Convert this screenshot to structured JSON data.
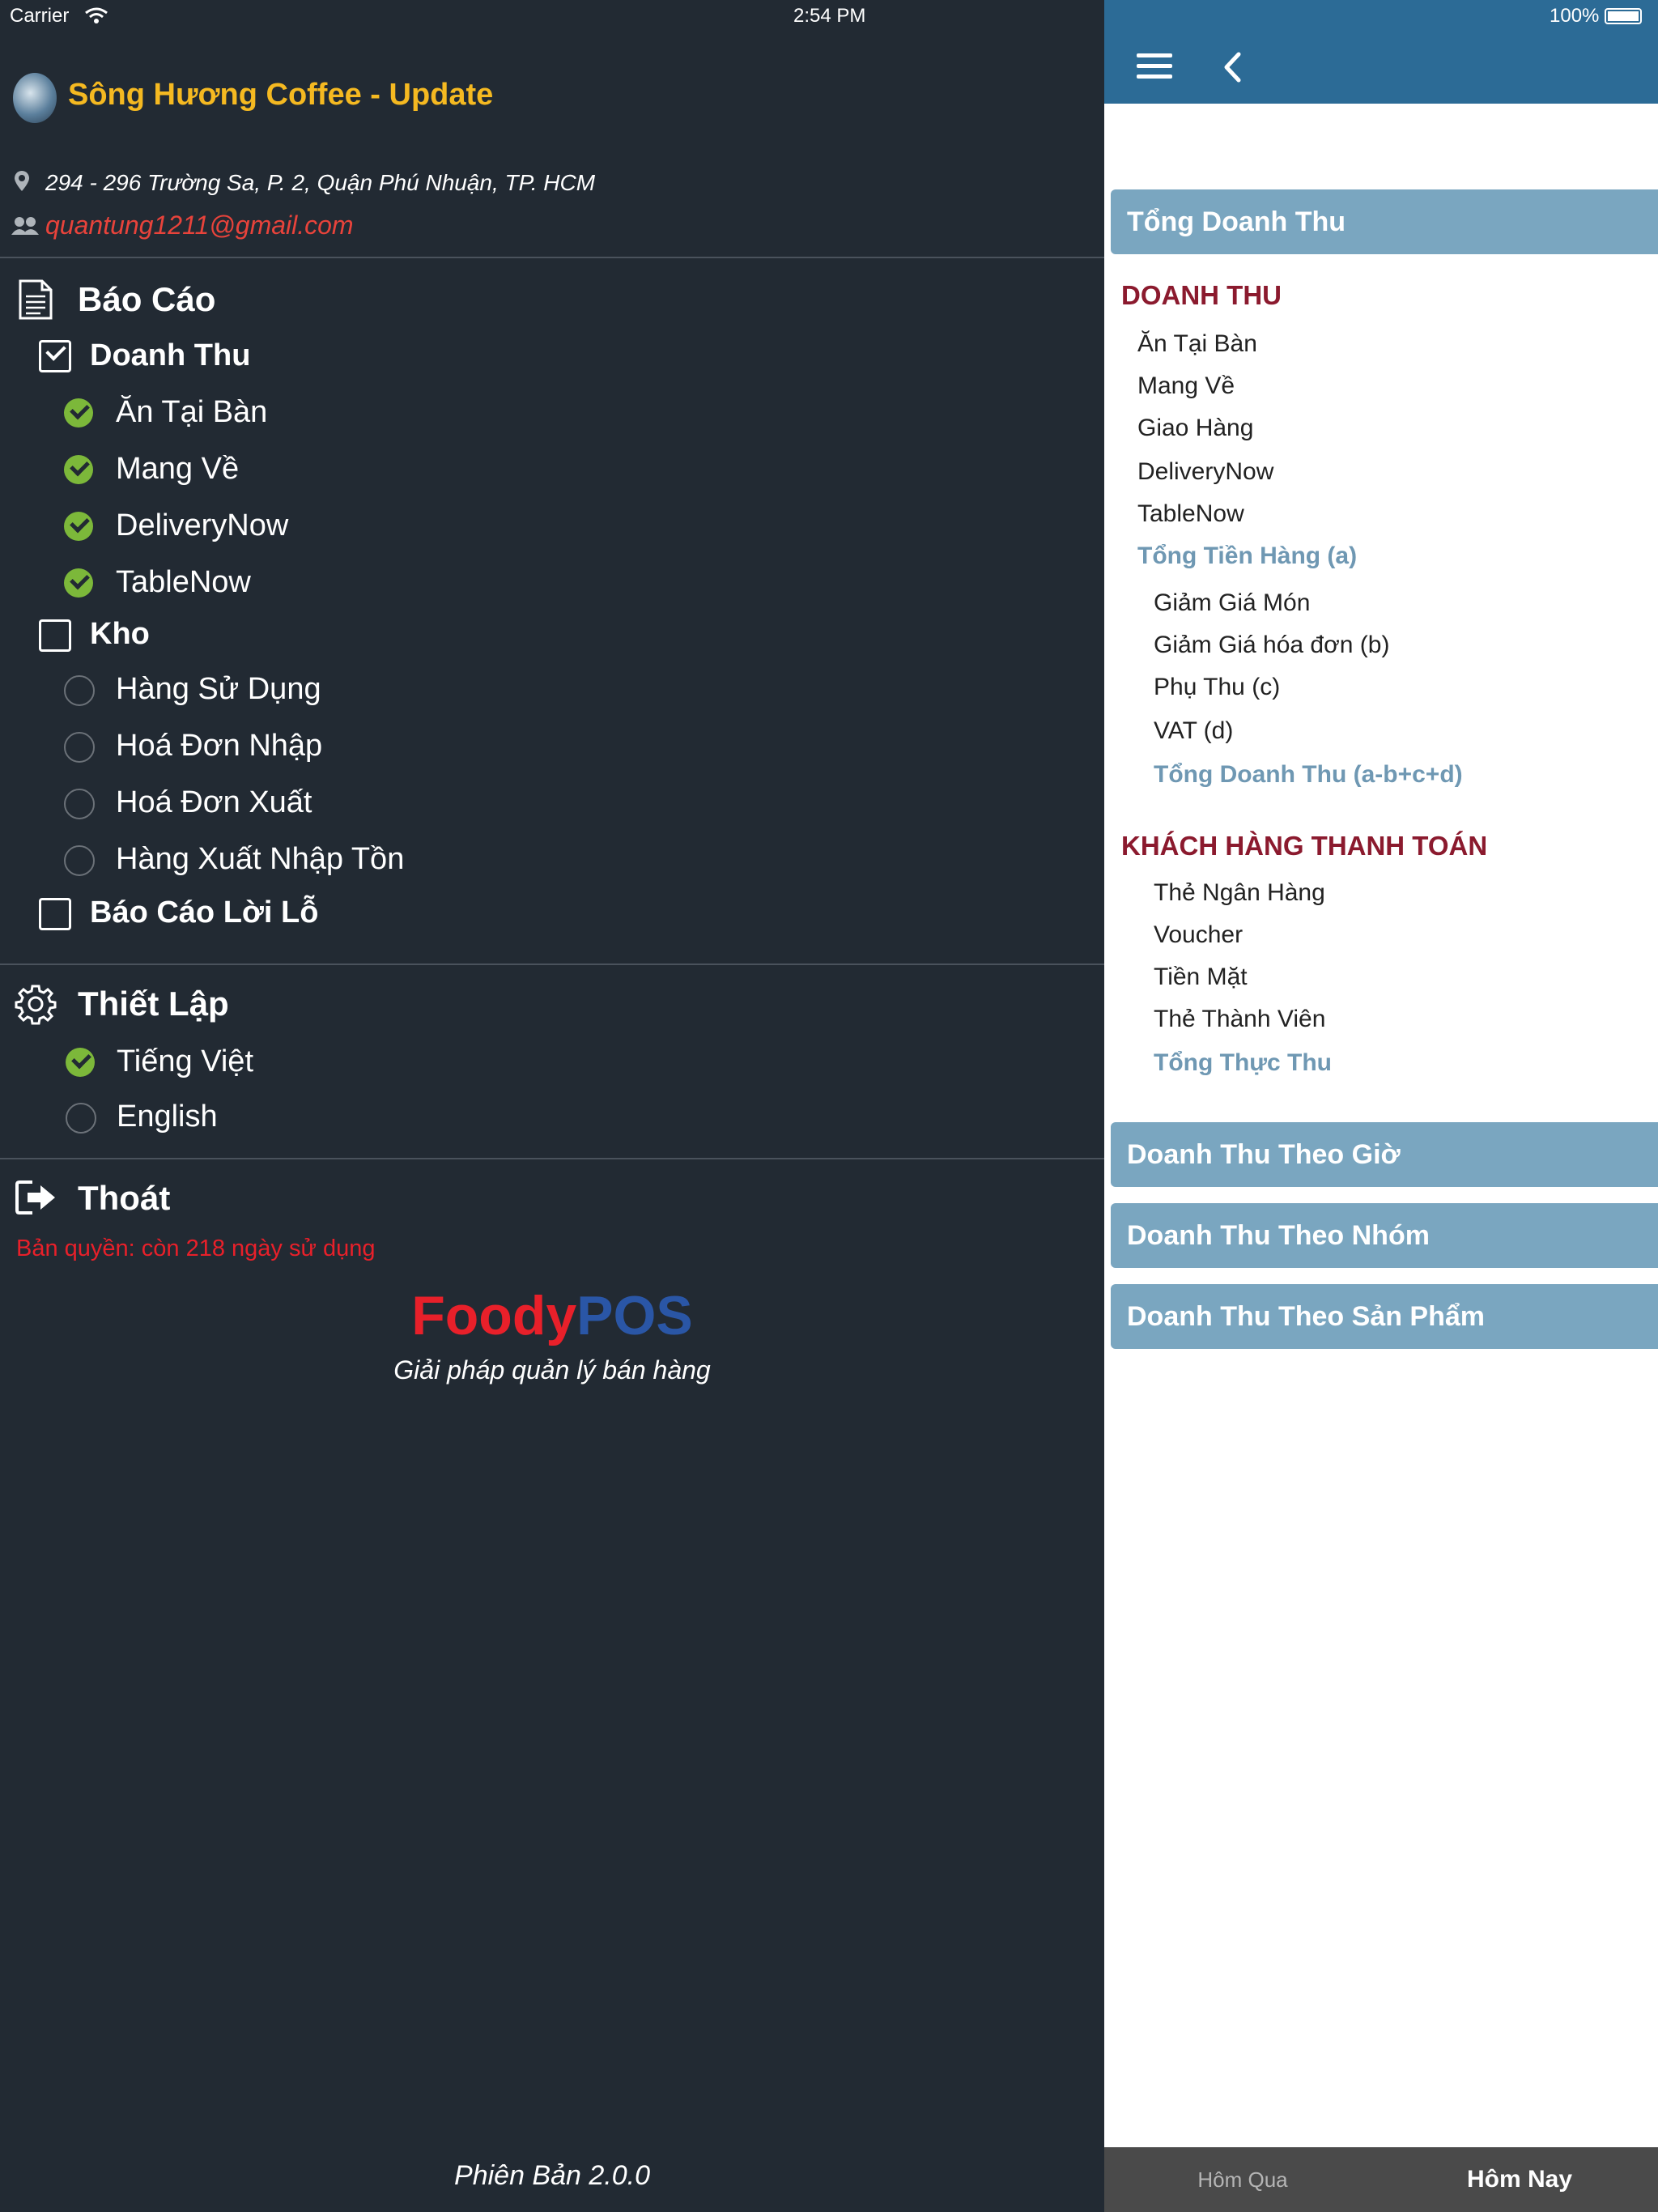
{
  "status_bar": {
    "carrier": "Carrier",
    "time": "2:54 PM",
    "battery": "100%"
  },
  "store": {
    "name": "Sông Hương Coffee - Update",
    "address": "294 - 296 Trường Sa, P. 2,  Quận Phú Nhuận, TP. HCM",
    "email": "quantung1211@gmail.com"
  },
  "menu": {
    "reports": {
      "title": "Báo Cáo",
      "revenue": {
        "label": "Doanh Thu",
        "checked": true,
        "items": [
          "Ăn Tại Bàn",
          "Mang Về",
          "DeliveryNow",
          "TableNow"
        ]
      },
      "inventory": {
        "label": "Kho",
        "checked": false,
        "items": [
          "Hàng Sử Dụng",
          "Hoá Đơn Nhập",
          "Hoá Đơn Xuất",
          "Hàng Xuất Nhập Tồn"
        ]
      },
      "profit_loss": {
        "label": "Báo Cáo Lời Lỗ",
        "checked": false
      }
    },
    "settings": {
      "title": "Thiết Lập",
      "languages": [
        "Tiếng Việt",
        "English"
      ],
      "selected_language": "Tiếng Việt"
    },
    "logout": "Thoát",
    "license": "Bản quyền:  còn 218 ngày sử dụng"
  },
  "brand": {
    "name_part1": "Foody",
    "name_part2": "POS",
    "tagline": "Giải pháp quản lý bán hàng",
    "color1": "#e8202a",
    "color2": "#2a56a6"
  },
  "version": "Phiên Bản 2.0.0",
  "report": {
    "total_revenue_header": "Tổng Doanh Thu",
    "revenue_section": "DOANH THU",
    "revenue_items": [
      "Ăn Tại Bàn",
      "Mang Về",
      "Giao Hàng",
      "DeliveryNow",
      "TableNow"
    ],
    "subtotal_a": "Tổng Tiền Hàng (a)",
    "adjust_items": [
      "Giảm Giá Món",
      "Giảm Giá hóa đơn (b)",
      "Phụ Thu (c)",
      "VAT (d)"
    ],
    "total_revenue_formula": "Tổng Doanh Thu (a-b+c+d)",
    "payment_section": "KHÁCH HÀNG THANH TOÁN",
    "payment_items": [
      "Thẻ Ngân Hàng",
      "Voucher",
      "Tiền Mặt",
      "Thẻ Thành Viên"
    ],
    "actual_total": "Tổng Thực Thu",
    "by_hour": "Doanh Thu Theo Giờ",
    "by_group": "Doanh Thu Theo Nhóm",
    "by_product": "Doanh Thu Theo Sản Phẩm"
  },
  "tabs": {
    "yesterday": "Hôm Qua",
    "today": "Hôm Nay",
    "active": "Hôm Nay"
  },
  "colors": {
    "nav_blue": "#2c6b96",
    "section_bar": "#7aa6c0",
    "section_red": "#8b1a2e",
    "accent_yellow": "#f5b921",
    "email_red": "#e8433b",
    "check_green": "#7cb83a"
  }
}
